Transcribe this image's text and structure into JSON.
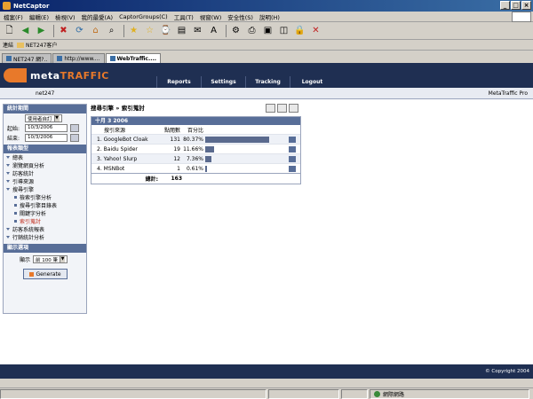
{
  "window": {
    "title": "NetCaptor"
  },
  "menu": [
    "檔案(F)",
    "編輯(E)",
    "檢視(V)",
    "我的最愛(A)",
    "CaptorGroups(C)",
    "工具(T)",
    "視窗(W)",
    "安全性(S)",
    "說明(H)"
  ],
  "address": {
    "label": "連結",
    "link": "NET247客户"
  },
  "tabs": [
    {
      "label": "NET247 網?.."
    },
    {
      "label": "http://www...."
    },
    {
      "label": "WebTraffic...."
    }
  ],
  "app": {
    "logo_meta": "meta",
    "logo_traffic": "TRAFFIC",
    "nav": [
      "Reports",
      "Settings",
      "Tracking",
      "Logout"
    ],
    "user": "net247",
    "product": "MetaTraffic Pro"
  },
  "sidebar": {
    "period_head": "統計期間",
    "period_select": "使用者自訂",
    "start_label": "起始:",
    "start_value": "10/3/2006",
    "end_label": "結束:",
    "end_value": "10/3/2006",
    "reports_head": "報表類型",
    "items": [
      {
        "label": "總表"
      },
      {
        "label": "瀏覽網頁分析"
      },
      {
        "label": "訪客統計"
      },
      {
        "label": "引導來源"
      },
      {
        "label": "搜尋引擎"
      },
      {
        "label": "檢索引擎分析"
      },
      {
        "label": "搜尋引擎目錄表"
      },
      {
        "label": "關鍵字分析"
      },
      {
        "label": "索引蒐討"
      },
      {
        "label": "訪客系統報表"
      },
      {
        "label": "行銷統計分析"
      }
    ],
    "display_head": "顯示選項",
    "show_label": "顯示",
    "show_value": "前 100 筆",
    "generate": "Generate"
  },
  "report": {
    "breadcrumb": "搜尋引擎 » 索引蒐討",
    "date_head": "十月 3 2006",
    "col_source": "搜引來源",
    "col_hits": "點閱數",
    "col_pct": "百分比",
    "rows": [
      {
        "rank": "1.",
        "name": "GoogleBot Cloak",
        "hits": "131",
        "pct": "80.37%",
        "ratio": 0.8037
      },
      {
        "rank": "2.",
        "name": "Baidu Spider",
        "hits": "19",
        "pct": "11.66%",
        "ratio": 0.1166
      },
      {
        "rank": "3.",
        "name": "Yahoo! Slurp",
        "hits": "12",
        "pct": "7.36%",
        "ratio": 0.0736
      },
      {
        "rank": "4.",
        "name": "MSNBot",
        "hits": "1",
        "pct": "0.61%",
        "ratio": 0.0061
      }
    ],
    "total_label": "總計:",
    "total_value": "163"
  },
  "footer": {
    "copyright": "© Copyright 2004"
  },
  "status": {
    "zone": "網際網路"
  }
}
